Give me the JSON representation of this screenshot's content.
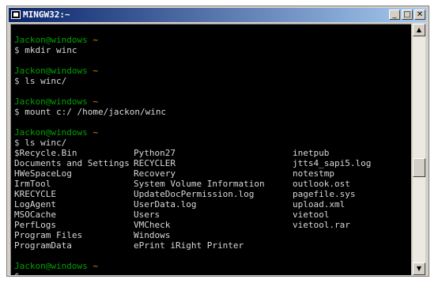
{
  "window": {
    "title": "MINGW32:~"
  },
  "controls": {
    "minimize": "_",
    "maximize": "□",
    "close": "✕"
  },
  "prompt": {
    "user": "Jackon@windows",
    "dir": "~",
    "symbol": "$"
  },
  "commands": [
    "mkdir winc",
    "ls winc/",
    "mount c:/ /home/jackon/winc",
    "ls winc/"
  ],
  "listing": [
    [
      "$Recycle.Bin",
      "Python27",
      "inetpub"
    ],
    [
      "Documents and Settings",
      "RECYCLER",
      "jtts4_sapi5.log"
    ],
    [
      "HWeSpaceLog",
      "Recovery",
      "notestmp"
    ],
    [
      "IrmTool",
      "System Volume Information",
      "outlook.ost"
    ],
    [
      "KRECYCLE",
      "UpdateDocPermission.log",
      "pagefile.sys"
    ],
    [
      "LogAgent",
      "UserData.log",
      "upload.xml"
    ],
    [
      "MSOCache",
      "Users",
      "vietool"
    ],
    [
      "PerfLogs",
      "VMCheck",
      "vietool.rar"
    ],
    [
      "Program Files",
      "Windows",
      ""
    ],
    [
      "ProgramData",
      "ePrint iRight Printer",
      ""
    ]
  ],
  "scrollbar": {
    "up_arrow": "▲",
    "down_arrow": "▼"
  }
}
